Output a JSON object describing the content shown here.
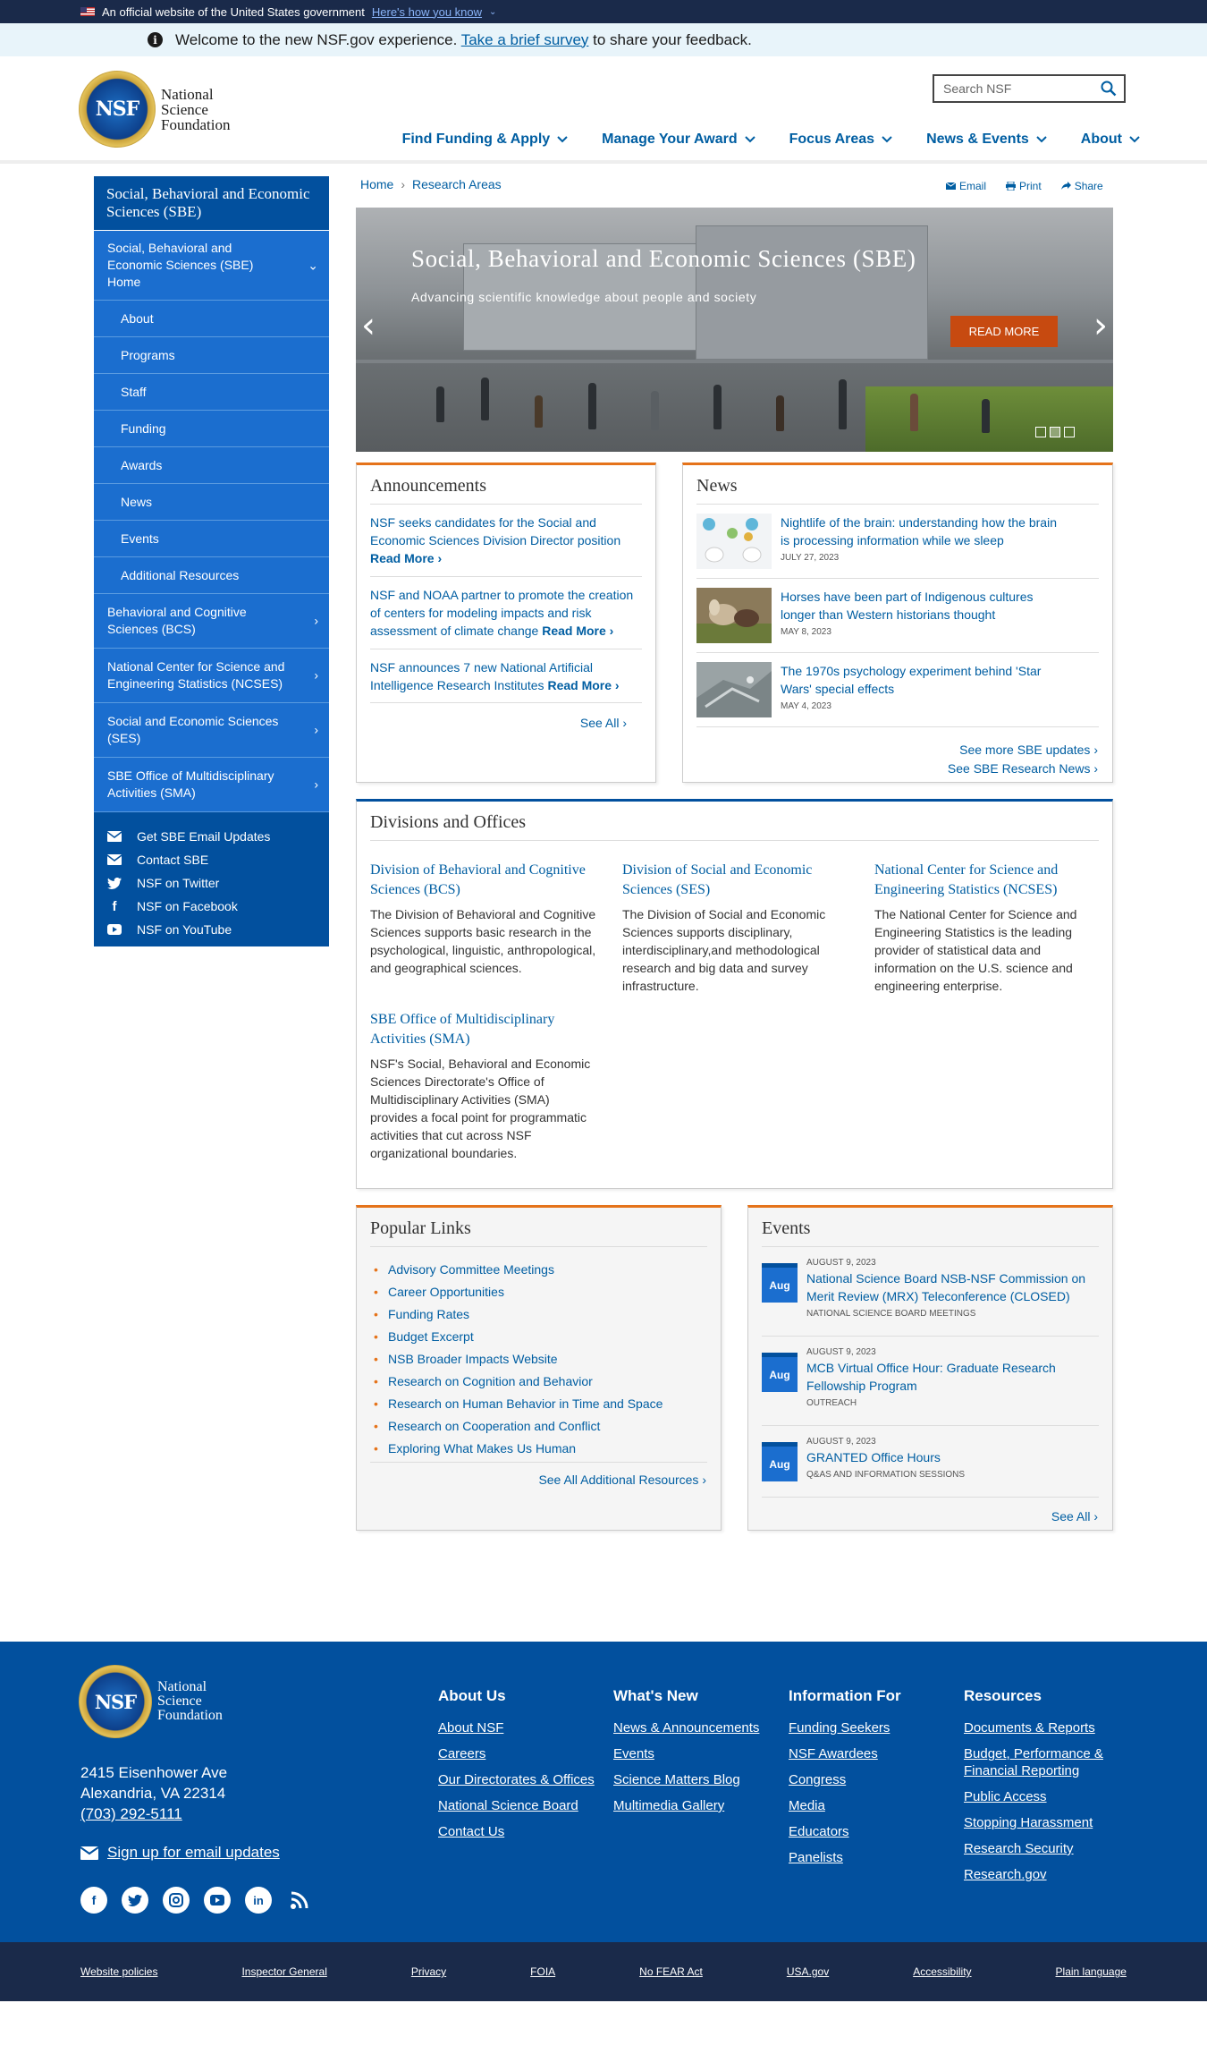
{
  "gov_banner": {
    "text": "An official website of the United States government",
    "link": "Here's how you know"
  },
  "welcome": {
    "before": "Welcome to the new NSF.gov experience.",
    "link": "Take a brief survey",
    "after": "to share your feedback."
  },
  "logo": {
    "line1": "National",
    "line2": "Science",
    "line3": "Foundation",
    "seal": "NSF"
  },
  "search": {
    "placeholder": "Search NSF"
  },
  "nav": [
    "Find Funding & Apply",
    "Manage Your Award",
    "Focus Areas",
    "News & Events",
    "About"
  ],
  "sidebar": {
    "title": "Social, Behavioral and Economic Sciences (SBE)",
    "home": "Social, Behavioral and Economic Sciences (SBE) Home",
    "subitems": [
      "About",
      "Programs",
      "Staff",
      "Funding",
      "Awards",
      "News",
      "Events",
      "Additional Resources"
    ],
    "divisions": [
      "Behavioral and Cognitive Sciences (BCS)",
      "National Center for Science and Engineering Statistics (NCSES)",
      "Social and Economic Sciences (SES)",
      "SBE Office of Multidisciplinary Activities (SMA)"
    ],
    "links": [
      "Get SBE Email Updates",
      "Contact SBE",
      "NSF on Twitter",
      "NSF on Facebook",
      "NSF on YouTube"
    ]
  },
  "breadcrumb": {
    "home": "Home",
    "sep": "›",
    "current": "Research Areas"
  },
  "share": {
    "email": "Email",
    "print": "Print",
    "share": "Share"
  },
  "hero": {
    "title": "Social, Behavioral and Economic Sciences (SBE)",
    "subtitle": "Advancing scientific knowledge about people and society",
    "button": "READ MORE"
  },
  "announcements": {
    "title": "Announcements",
    "items": [
      {
        "text": "NSF seeks candidates for the Social and Economic Sciences Division Director position",
        "more": "Read More ›"
      },
      {
        "text": "NSF and NOAA partner to promote the creation of centers for modeling impacts and risk assessment of climate change",
        "more": "Read More ›"
      },
      {
        "text": "NSF announces 7 new National Artificial Intelligence Research Institutes",
        "more": "Read More ›"
      }
    ],
    "see_all": "See All ›"
  },
  "news": {
    "title": "News",
    "items": [
      {
        "title": "Nightlife of the brain: understanding how the brain is processing information while we sleep",
        "date": "JULY 27, 2023"
      },
      {
        "title": "Horses have been part of Indigenous cultures longer than Western historians thought",
        "date": "MAY 8, 2023"
      },
      {
        "title": "The 1970s psychology experiment behind 'Star Wars' special effects",
        "date": "MAY 4, 2023"
      }
    ],
    "more1": "See more SBE updates ›",
    "more2": "See SBE Research News ›"
  },
  "divisions": {
    "title": "Divisions and Offices",
    "items": [
      {
        "name": "Division of Behavioral and Cognitive Sciences (BCS)",
        "desc": "The Division of Behavioral and Cognitive Sciences supports basic research in the psychological, linguistic, anthropological, and geographical sciences."
      },
      {
        "name": "Division of Social and Economic Sciences (SES)",
        "desc": "The Division of Social and Economic Sciences supports disciplinary, interdisciplinary,and methodological research and big data and survey infrastructure."
      },
      {
        "name": "National Center for Science and Engineering Statistics (NCSES)",
        "desc": "The National Center for Science and Engineering Statistics is the leading provider of statistical data and information on the U.S. science and engineering enterprise."
      },
      {
        "name": "SBE Office of Multidisciplinary Activities (SMA)",
        "desc": "NSF's Social, Behavioral and Economic Sciences Directorate's Office of Multidisciplinary Activities (SMA) provides a focal point for programmatic activities that cut across NSF organizational boundaries."
      }
    ]
  },
  "popular": {
    "title": "Popular Links",
    "items": [
      "Advisory Committee Meetings",
      "Career Opportunities",
      "Funding Rates",
      "Budget Excerpt",
      "NSB Broader Impacts Website",
      "Research on Cognition and Behavior",
      "Research on Human Behavior in Time and Space",
      "Research on Cooperation and Conflict",
      "Exploring What Makes Us Human"
    ],
    "see_all": "See All Additional Resources ›"
  },
  "events": {
    "title": "Events",
    "items": [
      {
        "month": "Aug",
        "date": "AUGUST 9, 2023",
        "title": "National Science Board NSB-NSF Commission on Merit Review (MRX) Teleconference (CLOSED)",
        "category": "NATIONAL SCIENCE BOARD MEETINGS"
      },
      {
        "month": "Aug",
        "date": "AUGUST 9, 2023",
        "title": "MCB Virtual Office Hour: Graduate Research Fellowship Program",
        "category": "OUTREACH"
      },
      {
        "month": "Aug",
        "date": "AUGUST 9, 2023",
        "title": "GRANTED Office Hours",
        "category": "Q&AS AND INFORMATION SESSIONS"
      }
    ],
    "see_all": "See All ›"
  },
  "footer": {
    "address1": "2415 Eisenhower Ave",
    "address2": "Alexandria, VA 22314",
    "phone": "(703) 292-5111",
    "email_signup": "Sign up for email updates",
    "columns": [
      {
        "title": "About Us",
        "links": [
          "About NSF",
          "Careers",
          "Our Directorates & Offices",
          "National Science Board",
          "Contact Us"
        ]
      },
      {
        "title": "What's New",
        "links": [
          "News & Announcements",
          "Events",
          "Science Matters Blog",
          "Multimedia Gallery"
        ]
      },
      {
        "title": "Information For",
        "links": [
          "Funding Seekers",
          "NSF Awardees",
          "Congress",
          "Media",
          "Educators",
          "Panelists"
        ]
      },
      {
        "title": "Resources",
        "links": [
          "Documents & Reports",
          "Budget, Performance & Financial Reporting",
          "Public Access",
          "Stopping Harassment",
          "Research Security",
          "Research.gov"
        ]
      }
    ],
    "bottom_links": [
      "Website policies",
      "Inspector General",
      "Privacy",
      "FOIA",
      "No FEAR Act",
      "USA.gov",
      "Accessibility",
      "Plain language"
    ]
  },
  "colors": {
    "primary": "#005ea2",
    "navy": "#02509e",
    "accent": "#e5731a",
    "hero_button": "#c74a10",
    "dark": "#1a2a4a"
  }
}
